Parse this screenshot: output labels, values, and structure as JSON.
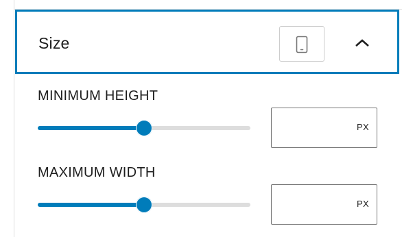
{
  "panel": {
    "title": "Size",
    "device_icon": "mobile-device-icon",
    "collapse_icon": "chevron-up-icon",
    "expanded": true,
    "accent_color": "#007cba"
  },
  "controls": [
    {
      "label": "MINIMUM HEIGHT",
      "value": "",
      "unit": "PX",
      "slider_fraction": 0.5
    },
    {
      "label": "MAXIMUM WIDTH",
      "value": "",
      "unit": "PX",
      "slider_fraction": 0.5
    }
  ]
}
